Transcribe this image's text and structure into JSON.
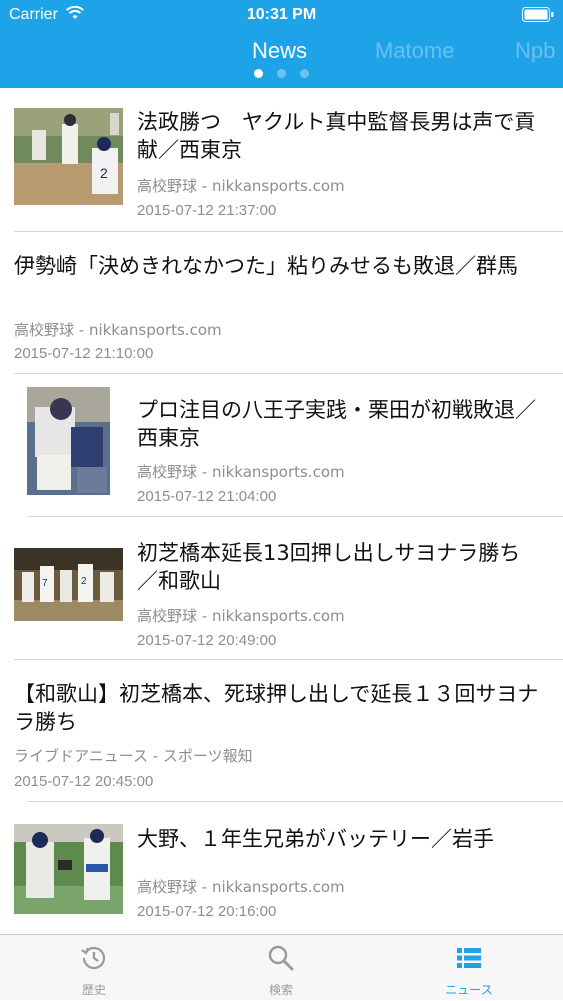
{
  "status_bar": {
    "carrier": "Carrier",
    "time": "10:31 PM"
  },
  "tabs": [
    {
      "label": "News",
      "active": true
    },
    {
      "label": "Matome",
      "active": false
    },
    {
      "label": "Npb",
      "active": false
    }
  ],
  "page_indicator": {
    "count": 3,
    "current": 1
  },
  "articles": [
    {
      "title": "法政勝つ　ヤクルト真中監督長男は声で貢献／西東京",
      "source": "高校野球 - nikkansports.com",
      "date": "2015-07-12 21:37:00",
      "has_thumb": true
    },
    {
      "title": "伊勢崎「決めきれなかつた」粘りみせるも敗退／群馬",
      "source": "高校野球 - nikkansports.com",
      "date": "2015-07-12 21:10:00",
      "has_thumb": false
    },
    {
      "title": "プロ注目の八王子実践・栗田が初戦敗退／西東京",
      "source": "高校野球 - nikkansports.com",
      "date": "2015-07-12 21:04:00",
      "has_thumb": true
    },
    {
      "title": "初芝橋本延長13回押し出しサヨナラ勝ち／和歌山",
      "source": "高校野球 - nikkansports.com",
      "date": "2015-07-12 20:49:00",
      "has_thumb": true
    },
    {
      "title": "【和歌山】初芝橋本、死球押し出しで延長１３回サヨナラ勝ち",
      "source": "ライブドアニュース - スポーツ報知",
      "date": "2015-07-12 20:45:00",
      "has_thumb": false
    },
    {
      "title": "大野、１年生兄弟がバッテリー／岩手",
      "source": "高校野球 - nikkansports.com",
      "date": "2015-07-12 20:16:00",
      "has_thumb": true
    }
  ],
  "tab_bar": [
    {
      "label": "歴史",
      "icon": "history-icon",
      "active": false
    },
    {
      "label": "検索",
      "icon": "search-icon",
      "active": false
    },
    {
      "label": "ニュース",
      "icon": "list-icon",
      "active": true
    }
  ],
  "colors": {
    "accent": "#1fa3e8",
    "text": "#111111",
    "meta": "#8e8e8e"
  }
}
